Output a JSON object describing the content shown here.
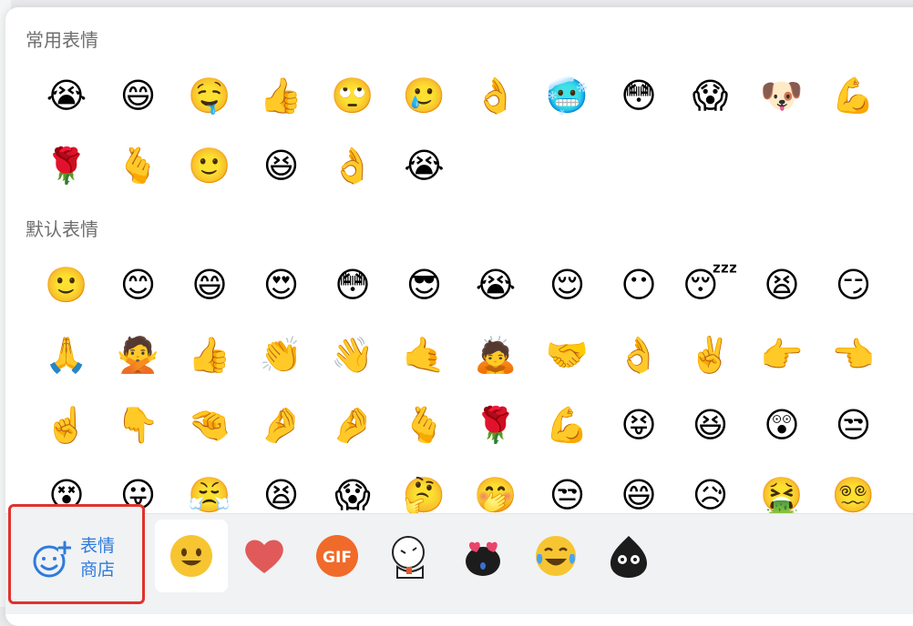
{
  "sections": {
    "frequent": {
      "title": "常用表情",
      "items": [
        "😭",
        "😄",
        "🤤",
        "👍",
        "🙄",
        "🥲",
        "👌",
        "🥶",
        "😳",
        "😱",
        "🐶",
        "💪",
        "🌹",
        "🫰",
        "🙂",
        "😆",
        "👌",
        "😭"
      ]
    },
    "default": {
      "title": "默认表情",
      "items": [
        "🙂",
        "😊",
        "😄",
        "😍",
        "😳",
        "😎",
        "😭",
        "😌",
        "😶",
        "😴",
        "😫",
        "😏",
        "🙏",
        "🙅",
        "👍",
        "👏",
        "👋",
        "🤙",
        "🙇",
        "🤝",
        "👌",
        "✌️",
        "👉",
        "👈",
        "☝️",
        "👇",
        "🤏",
        "🤌",
        "🤌",
        "🫰",
        "🌹",
        "💪",
        "😝",
        "😆",
        "😲",
        "😒",
        "😵",
        "😛",
        "😤",
        "😫",
        "😱",
        "🤔",
        "🤭",
        "😒",
        "😄",
        "😥",
        "🤮",
        "😵‍💫"
      ]
    }
  },
  "store": {
    "line1": "表情",
    "line2": "商店"
  },
  "tabs": [
    {
      "name": "emoji-tab",
      "icon": "smiley-face-icon",
      "active": true
    },
    {
      "name": "favorites-tab",
      "icon": "heart-icon",
      "active": false
    },
    {
      "name": "gif-tab",
      "icon": "gif-icon",
      "label": "GIF",
      "active": false
    },
    {
      "name": "sticker-pack-1-tab",
      "icon": "cartoon-person-icon",
      "active": false
    },
    {
      "name": "sticker-pack-2-tab",
      "icon": "black-heart-eyes-icon",
      "active": false
    },
    {
      "name": "sticker-pack-3-tab",
      "icon": "laugh-cry-icon",
      "active": false
    },
    {
      "name": "sticker-pack-4-tab",
      "icon": "black-blob-icon",
      "active": false
    }
  ],
  "colors": {
    "accent": "#2f7bdc",
    "highlight": "#e0332c",
    "gif": "#f06a2a"
  }
}
